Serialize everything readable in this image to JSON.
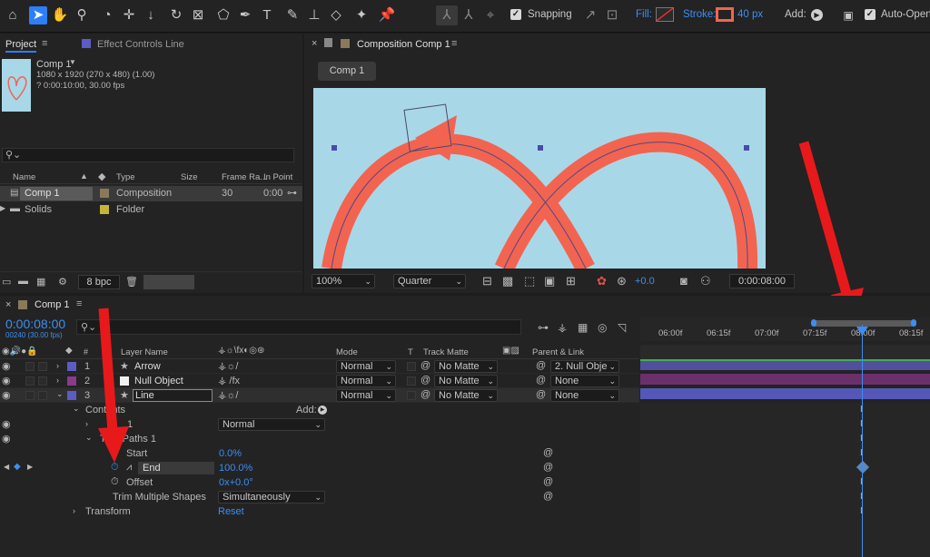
{
  "toolbar": {
    "snapping_label": "Snapping",
    "fill_label": "Fill:",
    "stroke_label": "Stroke:",
    "stroke_width": "40 px",
    "add_label": "Add:",
    "auto_open_label": "Auto-Open"
  },
  "project_panel": {
    "tab_project": "Project",
    "tab_effect_controls": "Effect Controls Line",
    "comp_name": "Comp 1",
    "comp_info_size": "1080 x 1920  (270 x 480) (1.00)",
    "comp_info_duration": "? 0:00:10:00, 30.00 fps",
    "search_placeholder": "",
    "columns": {
      "name": "Name",
      "type": "Type",
      "size": "Size",
      "frame_rate": "Frame Ra...",
      "in_point": "In Point"
    },
    "items": [
      {
        "name": "Comp 1",
        "type": "Composition",
        "frame_rate": "30",
        "in_point": "0:00",
        "swatch": "#8a7a5a"
      },
      {
        "name": "Solids",
        "type": "Folder",
        "frame_rate": "",
        "in_point": "",
        "swatch": "#c7b53a"
      }
    ],
    "bpc": "8 bpc"
  },
  "composition_panel": {
    "tab_title": "Composition Comp 1",
    "comp_button": "Comp 1",
    "zoom": "100%",
    "quality": "Quarter",
    "exposure": "+0.0",
    "timecode": "0:00:08:00",
    "bg_color": "#a8d8e8",
    "stroke_color": "#f26450"
  },
  "timeline": {
    "tab_title": "Comp 1",
    "current_time": "0:00:08:00",
    "frame_info": "00240 (30.00 fps)",
    "ruler_ticks": [
      "06:00f",
      "06:15f",
      "07:00f",
      "07:15f",
      "08:00f",
      "08:15f"
    ],
    "columns": {
      "layer_name": "Layer Name",
      "mode": "Mode",
      "t": "T",
      "track_matte": "Track Matte",
      "parent_link": "Parent & Link"
    },
    "layers": [
      {
        "num": "1",
        "name": "Arrow",
        "mode": "Normal",
        "matte": "No Matte",
        "parent": "2. Null Obje",
        "color": "#5c5cc4"
      },
      {
        "num": "2",
        "name": "Null Object",
        "mode": "Normal",
        "matte": "No Matte",
        "parent": "None",
        "color": "#8a3a8a"
      },
      {
        "num": "3",
        "name": "Line",
        "mode": "Normal",
        "matte": "No Matte",
        "parent": "None",
        "color": "#5c5cc4"
      }
    ],
    "contents_label": "Contents",
    "add_label": "Add:",
    "shape_group": "1",
    "shape_mode": "Normal",
    "trim_paths": "Trim Paths 1",
    "props": [
      {
        "name": "Start",
        "value": "0.0%"
      },
      {
        "name": "End",
        "value": "100.0%"
      },
      {
        "name": "Offset",
        "value": "0x+0.0°"
      }
    ],
    "trim_multiple_label": "Trim Multiple Shapes",
    "trim_multiple_value": "Simultaneously",
    "transform_label": "Transform",
    "reset_label": "Reset"
  }
}
